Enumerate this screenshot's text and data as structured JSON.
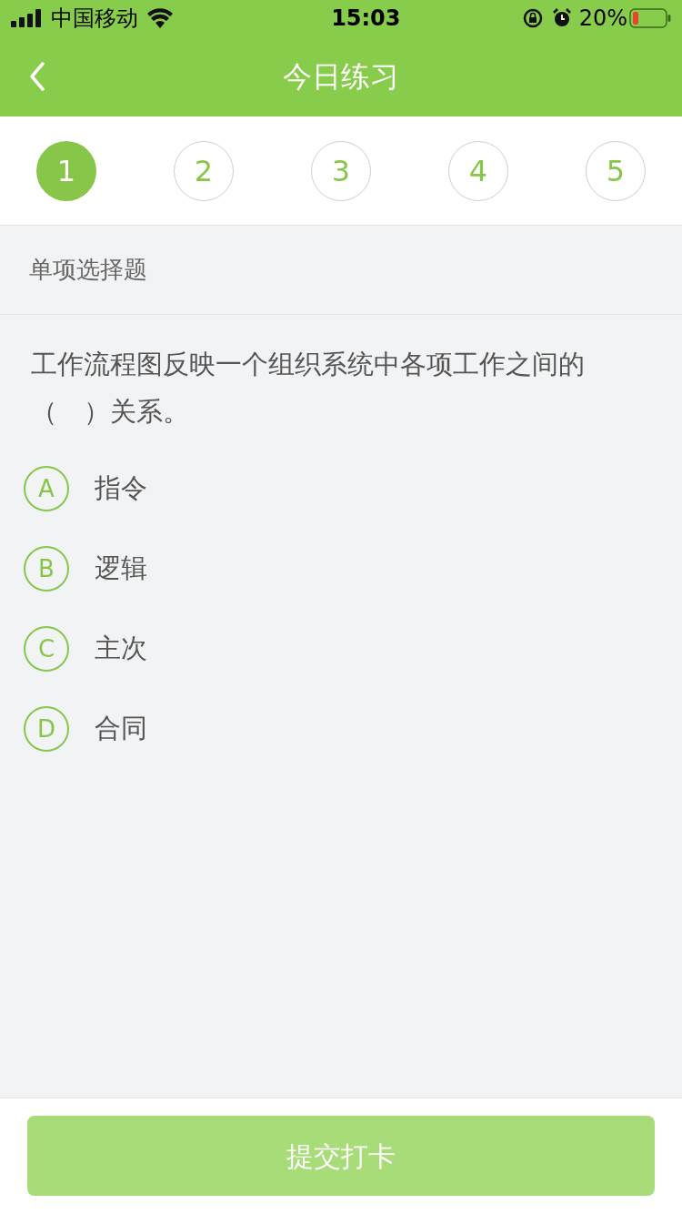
{
  "status_bar": {
    "carrier": "中国移动",
    "time": "15:03",
    "battery": "20%"
  },
  "nav": {
    "title": "今日练习"
  },
  "steps": [
    {
      "label": "1",
      "selected": true
    },
    {
      "label": "2",
      "selected": false
    },
    {
      "label": "3",
      "selected": false
    },
    {
      "label": "4",
      "selected": false
    },
    {
      "label": "5",
      "selected": false
    }
  ],
  "section": {
    "title": "单项选择题"
  },
  "question": {
    "text": "工作流程图反映一个组织系统中各项工作之间的（　）关系。",
    "options": [
      {
        "letter": "A",
        "text": "指令",
        "selected": false
      },
      {
        "letter": "B",
        "text": "逻辑",
        "selected": false
      },
      {
        "letter": "C",
        "text": "主次",
        "selected": false
      },
      {
        "letter": "D",
        "text": "合同",
        "selected": false
      }
    ]
  },
  "submit": {
    "label": "提交打卡",
    "disabled": true
  }
}
